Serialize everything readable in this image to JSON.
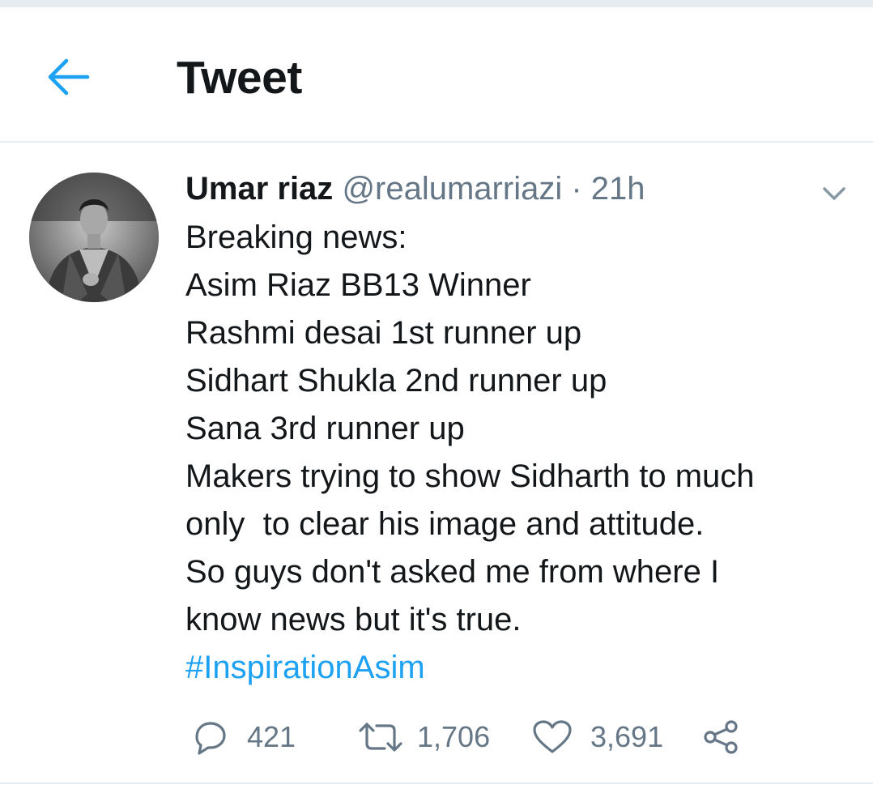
{
  "header": {
    "title": "Tweet",
    "back_icon": "arrow-left-icon"
  },
  "colors": {
    "accent": "#1da1f2",
    "text_primary": "#14171a",
    "text_secondary": "#657786",
    "divider": "#e6ecf0"
  },
  "tweet": {
    "author_name": "Umar riaz",
    "author_handle": "@realumarriazi",
    "separator": "·",
    "timestamp": "21h",
    "menu_icon": "chevron-down-icon",
    "body_lines": [
      "Breaking news:",
      "Asim Riaz BB13 Winner",
      "Rashmi desai 1st runner up",
      "Sidhart Shukla 2nd runner up",
      "Sana 3rd runner up",
      "Makers trying to show Sidharth to much",
      "only  to clear his image and attitude.",
      "So guys don't asked me from where I",
      "know news but it's true."
    ],
    "hashtag": "#InspirationAsim",
    "actions": {
      "reply_count": "421",
      "retweet_count": "1,706",
      "like_count": "3,691",
      "reply_icon": "reply-bubble-icon",
      "retweet_icon": "retweet-icon",
      "like_icon": "heart-icon",
      "share_icon": "share-icon"
    }
  }
}
